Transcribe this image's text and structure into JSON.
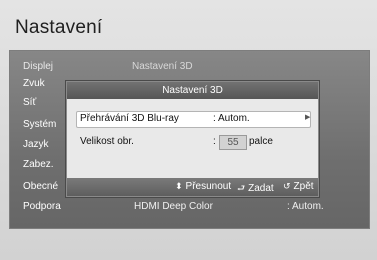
{
  "screen": {
    "title": "Nastavení"
  },
  "menu": {
    "items": [
      {
        "label": "Displej"
      },
      {
        "label": "Zvuk"
      },
      {
        "label": "Síť"
      },
      {
        "label": "Systém"
      },
      {
        "label": "Jazyk"
      },
      {
        "label": "Zabez."
      },
      {
        "label": "Obecné"
      },
      {
        "label": "Podpora"
      }
    ]
  },
  "content": {
    "header_label": "Nastavení 3D",
    "bottom_label": "HDMI Deep Color",
    "bottom_value": ": Autom."
  },
  "popup": {
    "title": "Nastavení 3D",
    "rows": [
      {
        "label": "Přehrávání 3D Blu-ray",
        "value": ": Autom."
      },
      {
        "label": "Velikost obr.",
        "value_prefix": ":",
        "value": "55",
        "unit": "palce"
      }
    ],
    "help": {
      "move": "Přesunout",
      "enter": "Zadat",
      "back": "Zpět"
    }
  },
  "icons": {
    "move": "up-down-arrows-icon",
    "enter": "enter-icon",
    "back": "return-icon",
    "right": "right-arrow-icon"
  }
}
